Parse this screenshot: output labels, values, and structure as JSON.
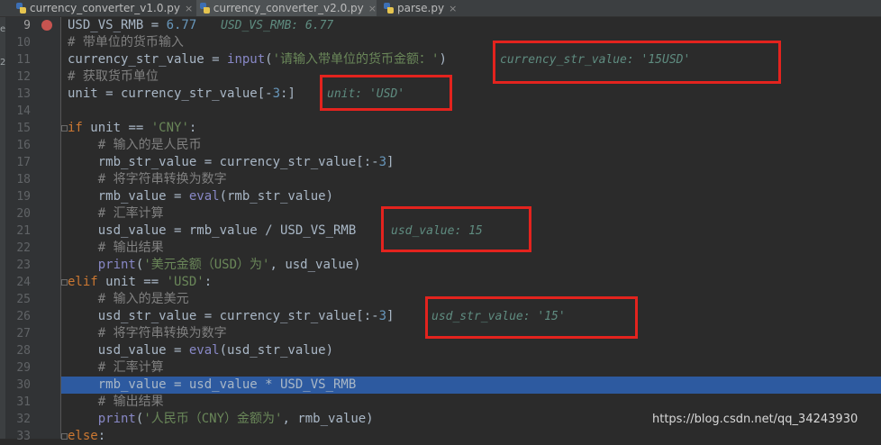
{
  "tabs": [
    {
      "label": "currency_converter_v1.0.py",
      "close": "×"
    },
    {
      "label": "currency_converter_v2.0.py",
      "close": "×"
    },
    {
      "label": "parse.py",
      "close": "×"
    }
  ],
  "left_edge": [
    "e",
    "2"
  ],
  "lines": [
    {
      "num": "9",
      "tokens": [
        {
          "t": "USD_VS_RMB = ",
          "c": "tx"
        },
        {
          "t": "6.77",
          "c": "nm"
        }
      ]
    },
    {
      "num": "10",
      "tokens": [
        {
          "t": "# 带单位的货币输入",
          "c": "cm"
        }
      ]
    },
    {
      "num": "11",
      "tokens": [
        {
          "t": "currency_str_value = ",
          "c": "tx"
        },
        {
          "t": "input",
          "c": "bi"
        },
        {
          "t": "(",
          "c": "tx"
        },
        {
          "t": "'请输入带单位的货币金额：'",
          "c": "st"
        },
        {
          "t": ")",
          "c": "tx"
        }
      ]
    },
    {
      "num": "12",
      "tokens": [
        {
          "t": "# 获取货币单位",
          "c": "cm"
        }
      ]
    },
    {
      "num": "13",
      "tokens": [
        {
          "t": "unit = currency_str_value[-",
          "c": "tx"
        },
        {
          "t": "3",
          "c": "nm"
        },
        {
          "t": ":]",
          "c": "tx"
        }
      ]
    },
    {
      "num": "14",
      "tokens": []
    },
    {
      "num": "15",
      "tokens": [
        {
          "t": "if ",
          "c": "kw"
        },
        {
          "t": "unit == ",
          "c": "tx"
        },
        {
          "t": "'CNY'",
          "c": "st"
        },
        {
          "t": ":",
          "c": "tx"
        }
      ]
    },
    {
      "num": "16",
      "tokens": [
        {
          "t": "    # 输入的是人民币",
          "c": "cm"
        }
      ]
    },
    {
      "num": "17",
      "tokens": [
        {
          "t": "    rmb_str_value = currency_str_value[:-",
          "c": "tx"
        },
        {
          "t": "3",
          "c": "nm"
        },
        {
          "t": "]",
          "c": "tx"
        }
      ]
    },
    {
      "num": "18",
      "tokens": [
        {
          "t": "    # 将字符串转换为数字",
          "c": "cm"
        }
      ]
    },
    {
      "num": "19",
      "tokens": [
        {
          "t": "    rmb_value = ",
          "c": "tx"
        },
        {
          "t": "eval",
          "c": "bi"
        },
        {
          "t": "(rmb_str_value)",
          "c": "tx"
        }
      ]
    },
    {
      "num": "20",
      "tokens": [
        {
          "t": "    # 汇率计算",
          "c": "cm"
        }
      ]
    },
    {
      "num": "21",
      "tokens": [
        {
          "t": "    usd_value = rmb_value / USD_VS_RMB",
          "c": "tx"
        }
      ]
    },
    {
      "num": "22",
      "tokens": [
        {
          "t": "    # 输出结果",
          "c": "cm"
        }
      ]
    },
    {
      "num": "23",
      "tokens": [
        {
          "t": "    ",
          "c": "tx"
        },
        {
          "t": "print",
          "c": "bi"
        },
        {
          "t": "(",
          "c": "tx"
        },
        {
          "t": "'美元金额（USD）为'",
          "c": "st"
        },
        {
          "t": ", usd_value)",
          "c": "tx"
        }
      ]
    },
    {
      "num": "24",
      "tokens": [
        {
          "t": "elif ",
          "c": "kw"
        },
        {
          "t": "unit == ",
          "c": "tx"
        },
        {
          "t": "'USD'",
          "c": "st"
        },
        {
          "t": ":",
          "c": "tx"
        }
      ]
    },
    {
      "num": "25",
      "tokens": [
        {
          "t": "    # 输入的是美元",
          "c": "cm"
        }
      ]
    },
    {
      "num": "26",
      "tokens": [
        {
          "t": "    usd_str_value = currency_str_value[:-",
          "c": "tx"
        },
        {
          "t": "3",
          "c": "nm"
        },
        {
          "t": "]",
          "c": "tx"
        }
      ]
    },
    {
      "num": "27",
      "tokens": [
        {
          "t": "    # 将字符串转换为数字",
          "c": "cm"
        }
      ]
    },
    {
      "num": "28",
      "tokens": [
        {
          "t": "    usd_value = ",
          "c": "tx"
        },
        {
          "t": "eval",
          "c": "bi"
        },
        {
          "t": "(usd_str_value)",
          "c": "tx"
        }
      ]
    },
    {
      "num": "29",
      "tokens": [
        {
          "t": "    # 汇率计算",
          "c": "cm"
        }
      ]
    },
    {
      "num": "30",
      "tokens": [
        {
          "t": "    rmb_value = usd_value * USD_VS_RMB",
          "c": "tx"
        }
      ]
    },
    {
      "num": "31",
      "tokens": [
        {
          "t": "    # 输出结果",
          "c": "cm"
        }
      ]
    },
    {
      "num": "32",
      "tokens": [
        {
          "t": "    ",
          "c": "tx"
        },
        {
          "t": "print",
          "c": "bi"
        },
        {
          "t": "(",
          "c": "tx"
        },
        {
          "t": "'人民币（CNY）金额为'",
          "c": "st"
        },
        {
          "t": ", rmb_value)",
          "c": "tx"
        }
      ]
    },
    {
      "num": "33",
      "tokens": [
        {
          "t": "else",
          "c": "kw"
        },
        {
          "t": ":",
          "c": "tx"
        }
      ]
    }
  ],
  "inline_values": {
    "l9": "USD_VS_RMB: 6.77",
    "l11": "currency_str_value: '15USD'",
    "l13": "unit: 'USD'",
    "l21": "usd_value: 15",
    "l26": "usd_str_value: '15'"
  },
  "breakpoint_line": "9",
  "execution_line": "30",
  "watermark": "https://blog.csdn.net/qq_34243930",
  "colors": {
    "editor_bg": "#2b2b2b",
    "keyword": "#cc7832",
    "string": "#6a8759",
    "comment": "#808080",
    "number": "#6897bb",
    "builtin": "#8888c6",
    "execution_highlight": "#2d5aa0",
    "breakpoint": "#c75450",
    "annotation_box": "#e3231e"
  }
}
